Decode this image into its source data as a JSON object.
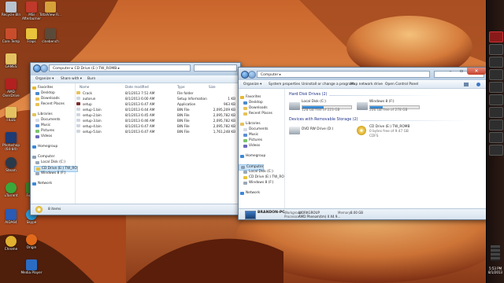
{
  "desktop": {
    "icons": [
      {
        "label": "Recycle Bin",
        "color": "#b9c3cf"
      },
      {
        "label": "MSI Afterburner",
        "color": "#c0392b"
      },
      {
        "label": "TotalView R...",
        "color": "#d7a13a"
      },
      {
        "label": "Core Temp",
        "color": "#c94d2c"
      },
      {
        "label": "Fraps",
        "color": "#e8c33b"
      },
      {
        "label": "cinebench",
        "color": "#5a4a3a"
      },
      {
        "label": "GAMES",
        "color": "#e5c261"
      },
      {
        "label": "AMD OverDrive",
        "color": "#b32020"
      },
      {
        "label": "FILES",
        "color": "#e5c261"
      },
      {
        "label": "Photoshop (64-bit)",
        "color": "#1f3b73"
      },
      {
        "label": "Steam",
        "color": "#2a3a4a"
      },
      {
        "label": "uTorrent",
        "color": "#3aa83a"
      },
      {
        "label": "Folder",
        "color": "#3a7d2a"
      },
      {
        "label": "AIDA64",
        "color": "#2a5bb5"
      },
      {
        "label": "Skype",
        "color": "#2aa0e0"
      },
      {
        "label": "Origin",
        "color": "#e06a1a"
      },
      {
        "label": "Media Player",
        "color": "#2a6cc4"
      },
      {
        "label": "Chrome",
        "color": "#e0b030"
      }
    ]
  },
  "taskbar": {
    "time": "5:53 PM",
    "date": "8/1/2013"
  },
  "cd_window": {
    "address": "Computer ▸ CD Drive (E:) TW_ROMB ▸",
    "toolbar": {
      "organize": "Organize ▾",
      "share": "Share with ▾",
      "burn": "Burn"
    },
    "nav": {
      "favorites": "Favorites",
      "desktop": "Desktop",
      "downloads": "Downloads",
      "recent": "Recent Places",
      "libraries": "Libraries",
      "documents": "Documents",
      "music": "Music",
      "pictures": "Pictures",
      "videos": "Videos",
      "homegroup": "Homegroup",
      "computer": "Computer",
      "local_disk": "Local Disk (C:)",
      "cd_drive": "CD Drive (E:) TW_RO",
      "windows8": "Windows 8 (F:)",
      "network": "Network"
    },
    "columns": {
      "name": "Name",
      "date": "Date modified",
      "type": "Type",
      "size": "Size"
    },
    "files": [
      {
        "name": "Crack",
        "date": "8/1/2013 7:51 AM",
        "type": "File folder",
        "size": "",
        "icon": "#e7c25b"
      },
      {
        "name": "autorun",
        "date": "8/1/2013 6:00 AM",
        "type": "Setup Information",
        "size": "1 KB",
        "icon": "#cfd6df"
      },
      {
        "name": "setup",
        "date": "8/1/2013 6:47 AM",
        "type": "Application",
        "size": "963 KB",
        "icon": "#7a2f2f"
      },
      {
        "name": "setup-1.bin",
        "date": "8/1/2013 6:44 AM",
        "type": "BIN File",
        "size": "2,095,209 KB",
        "icon": "#cfd6df"
      },
      {
        "name": "setup-2.bin",
        "date": "8/1/2013 6:45 AM",
        "type": "BIN File",
        "size": "2,095,782 KB",
        "icon": "#cfd6df"
      },
      {
        "name": "setup-3.bin",
        "date": "8/1/2013 6:46 AM",
        "type": "BIN File",
        "size": "2,095,782 KB",
        "icon": "#cfd6df"
      },
      {
        "name": "setup-4.bin",
        "date": "8/1/2013 6:47 AM",
        "type": "BIN File",
        "size": "2,095,782 KB",
        "icon": "#cfd6df"
      },
      {
        "name": "setup-5.bin",
        "date": "8/1/2013 6:47 AM",
        "type": "BIN File",
        "size": "1,761,248 KB",
        "icon": "#cfd6df"
      }
    ],
    "status": "8 items"
  },
  "computer_window": {
    "address": "Computer ▸",
    "toolbar": {
      "organize": "Organize ▾",
      "properties": "System properties",
      "uninstall": "Uninstall or change a program",
      "map": "Map network drive",
      "control": "Open Control Panel"
    },
    "nav": {
      "favorites": "Favorites",
      "desktop": "Desktop",
      "downloads": "Downloads",
      "recent": "Recent Places",
      "libraries": "Libraries",
      "documents": "Documents",
      "music": "Music",
      "pictures": "Pictures",
      "videos": "Videos",
      "homegroup": "Homegroup",
      "computer": "Computer",
      "local_disk": "Local Disk (C:)",
      "cd_drive": "CD Drive (E:) TW_RO",
      "windows8": "Windows 8 (F:)",
      "network": "Network"
    },
    "hard_disk_heading": "Hard Disk Drives (2)",
    "removable_heading": "Devices with Removable Storage (2)",
    "drives": [
      {
        "name": "Local Disk (C:)",
        "free": "128 GB free of 223 GB",
        "used": 0.43
      },
      {
        "name": "Windows 8 (F:)",
        "free": "206 GB free of 278 GB",
        "used": 0.26
      }
    ],
    "removable": [
      {
        "name": "DVD RW Drive (D:)",
        "sub": ""
      },
      {
        "name": "CD Drive (E:) TW_ROMB",
        "sub": "0 bytes free of 9.47 GB",
        "sub2": "CDFS"
      }
    ],
    "details": {
      "pc_name": "BRANDON-PC",
      "workgroup_label": "Workgroup:",
      "workgroup": "WORKGROUP",
      "memory_label": "Memory:",
      "memory": "8.00 GB",
      "processor_label": "Processor:",
      "processor": "AMD Phenom(tm) II X4 9..."
    }
  }
}
